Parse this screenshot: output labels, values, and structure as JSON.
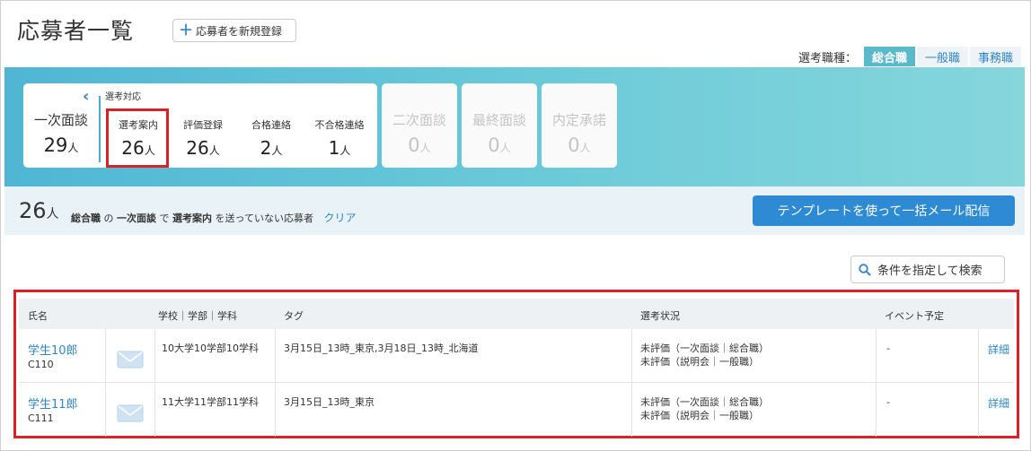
{
  "header": {
    "title": "応募者一覧",
    "new_button": "応募者を新規登録"
  },
  "job_type": {
    "label": "選考職種：",
    "options": [
      "総合職",
      "一般職",
      "事務職"
    ],
    "active": "総合職"
  },
  "stages": {
    "current": {
      "name": "一次面談",
      "count": "29",
      "unit": "人"
    },
    "sub_label": "選考対応",
    "sub": [
      {
        "name": "選考案内",
        "count": "26",
        "unit": "人"
      },
      {
        "name": "評価登録",
        "count": "26",
        "unit": "人"
      },
      {
        "name": "合格連絡",
        "count": "2",
        "unit": "人"
      },
      {
        "name": "不合格連絡",
        "count": "1",
        "unit": "人"
      }
    ],
    "others": [
      {
        "name": "二次面談",
        "count": "0",
        "unit": "人"
      },
      {
        "name": "最終面談",
        "count": "0",
        "unit": "人"
      },
      {
        "name": "内定承諾",
        "count": "0",
        "unit": "人"
      }
    ]
  },
  "summary": {
    "count": "26",
    "unit": "人",
    "job": "総合職",
    "p1": "の",
    "stage": "一次面談",
    "p2": "で",
    "action": "選考案内",
    "p3": "を送っていない応募者",
    "clear": "クリア"
  },
  "actions": {
    "mail_button": "テンプレートを使って一括メール配信",
    "search_button": "条件を指定して検索"
  },
  "table": {
    "headers": {
      "name": "氏名",
      "school": "学校｜学部｜学科",
      "tag": "タグ",
      "status": "選考状況",
      "event": "イベント予定"
    },
    "rows": [
      {
        "name": "学生10郎",
        "code": "C110",
        "school": "10大学10学部10学科",
        "tag": "3月15日_13時_東京,3月18日_13時_北海道",
        "status1": "未評価（一次面談｜総合職）",
        "status2": "未評価（説明会｜一般職）",
        "event": "-",
        "detail": "詳細"
      },
      {
        "name": "学生11郎",
        "code": "C111",
        "school": "11大学11学部11学科",
        "tag": "3月15日_13時_東京",
        "status1": "未評価（一次面談｜総合職）",
        "status2": "未評価（説明会｜一般職）",
        "event": "-",
        "detail": "詳細"
      }
    ]
  },
  "colors": {
    "accent": "#2d8ad3",
    "link": "#2f86c9",
    "highlight": "#dd1f26",
    "band": "#6ccbd8"
  }
}
